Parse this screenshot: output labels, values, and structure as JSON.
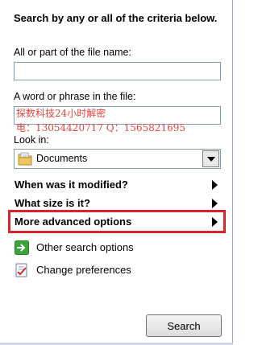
{
  "panel": {
    "heading": "Search by any or all of the criteria below.",
    "file_name_label": "All or part of the file name:",
    "file_name_value": "",
    "phrase_label": "A word or phrase in the file:",
    "phrase_value": "",
    "watermark_line1": "探数科技24小时解密",
    "watermark_line2": "电：13054420717 Q：1565821695",
    "look_in_label": "Look in:",
    "look_in_value": "Documents",
    "sections": [
      {
        "label": "When was it modified?"
      },
      {
        "label": "What size is it?"
      },
      {
        "label": "More advanced options"
      }
    ],
    "links": [
      {
        "label": "Other search options",
        "icon": "green-arrow-icon"
      },
      {
        "label": "Change preferences",
        "icon": "checklist-icon"
      }
    ],
    "search_button": "Search"
  },
  "colors": {
    "highlight": "#d9242b",
    "watermark": "#e2463e",
    "field_border": "#7f9db9"
  }
}
